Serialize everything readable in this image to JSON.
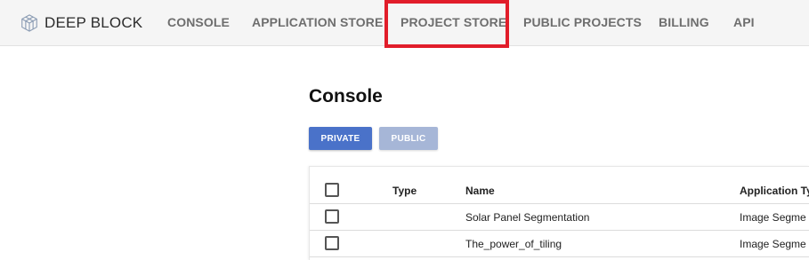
{
  "navbar": {
    "brand": "DEEP BLOCK",
    "items": [
      "CONSOLE",
      "APPLICATION STORE",
      "PROJECT STORE",
      "PUBLIC PROJECTS",
      "BILLING",
      "API"
    ],
    "highlighted_item": "PROJECT STORE",
    "highlight_color": "#e11d2a"
  },
  "page": {
    "title": "Console"
  },
  "toolbar": {
    "private_label": "PRIVATE",
    "public_label": "PUBLIC",
    "private_color": "#4a72c9",
    "public_color": "#a6b6d7"
  },
  "table": {
    "headers": [
      "Type",
      "Name",
      "Application Typ"
    ],
    "rows": [
      {
        "type": "",
        "name": "Solar Panel Segmentation",
        "application_type": "Image Segme"
      },
      {
        "type": "",
        "name": "The_power_of_tiling",
        "application_type": "Image Segme"
      }
    ]
  }
}
